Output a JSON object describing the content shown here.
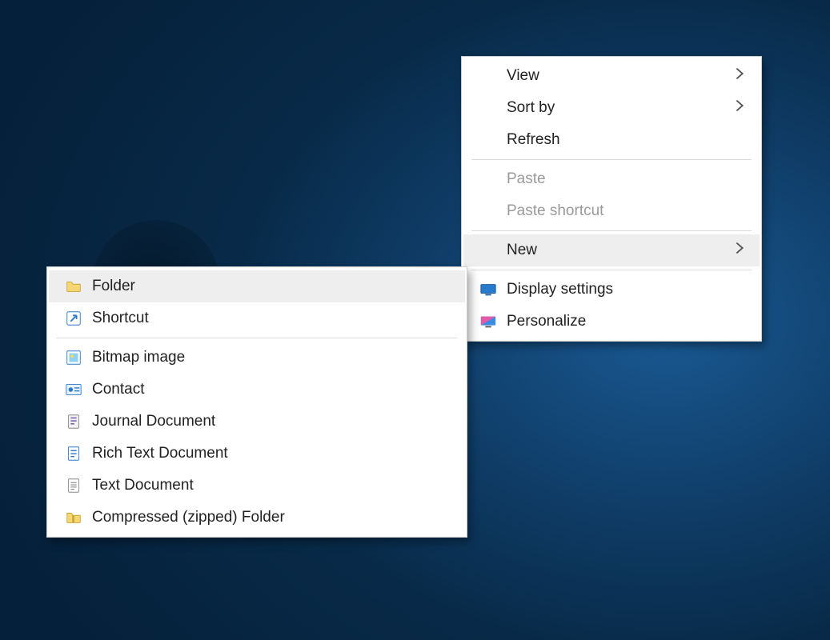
{
  "context_menu": {
    "view": {
      "label": "View",
      "disabled": false,
      "submenu": true
    },
    "sort_by": {
      "label": "Sort by",
      "disabled": false,
      "submenu": true
    },
    "refresh": {
      "label": "Refresh",
      "disabled": false,
      "submenu": false
    },
    "paste": {
      "label": "Paste",
      "disabled": true,
      "submenu": false
    },
    "paste_shortcut": {
      "label": "Paste shortcut",
      "disabled": true,
      "submenu": false
    },
    "new": {
      "label": "New",
      "disabled": false,
      "submenu": true,
      "highlighted": true
    },
    "display_settings": {
      "label": "Display settings",
      "disabled": false,
      "submenu": false
    },
    "personalize": {
      "label": "Personalize",
      "disabled": false,
      "submenu": false
    }
  },
  "new_submenu": {
    "folder": {
      "label": "Folder",
      "highlighted": true
    },
    "shortcut": {
      "label": "Shortcut"
    },
    "bitmap": {
      "label": "Bitmap image"
    },
    "contact": {
      "label": "Contact"
    },
    "journal": {
      "label": "Journal Document"
    },
    "rtf": {
      "label": "Rich Text Document"
    },
    "txt": {
      "label": "Text Document"
    },
    "zip": {
      "label": "Compressed (zipped) Folder"
    }
  }
}
